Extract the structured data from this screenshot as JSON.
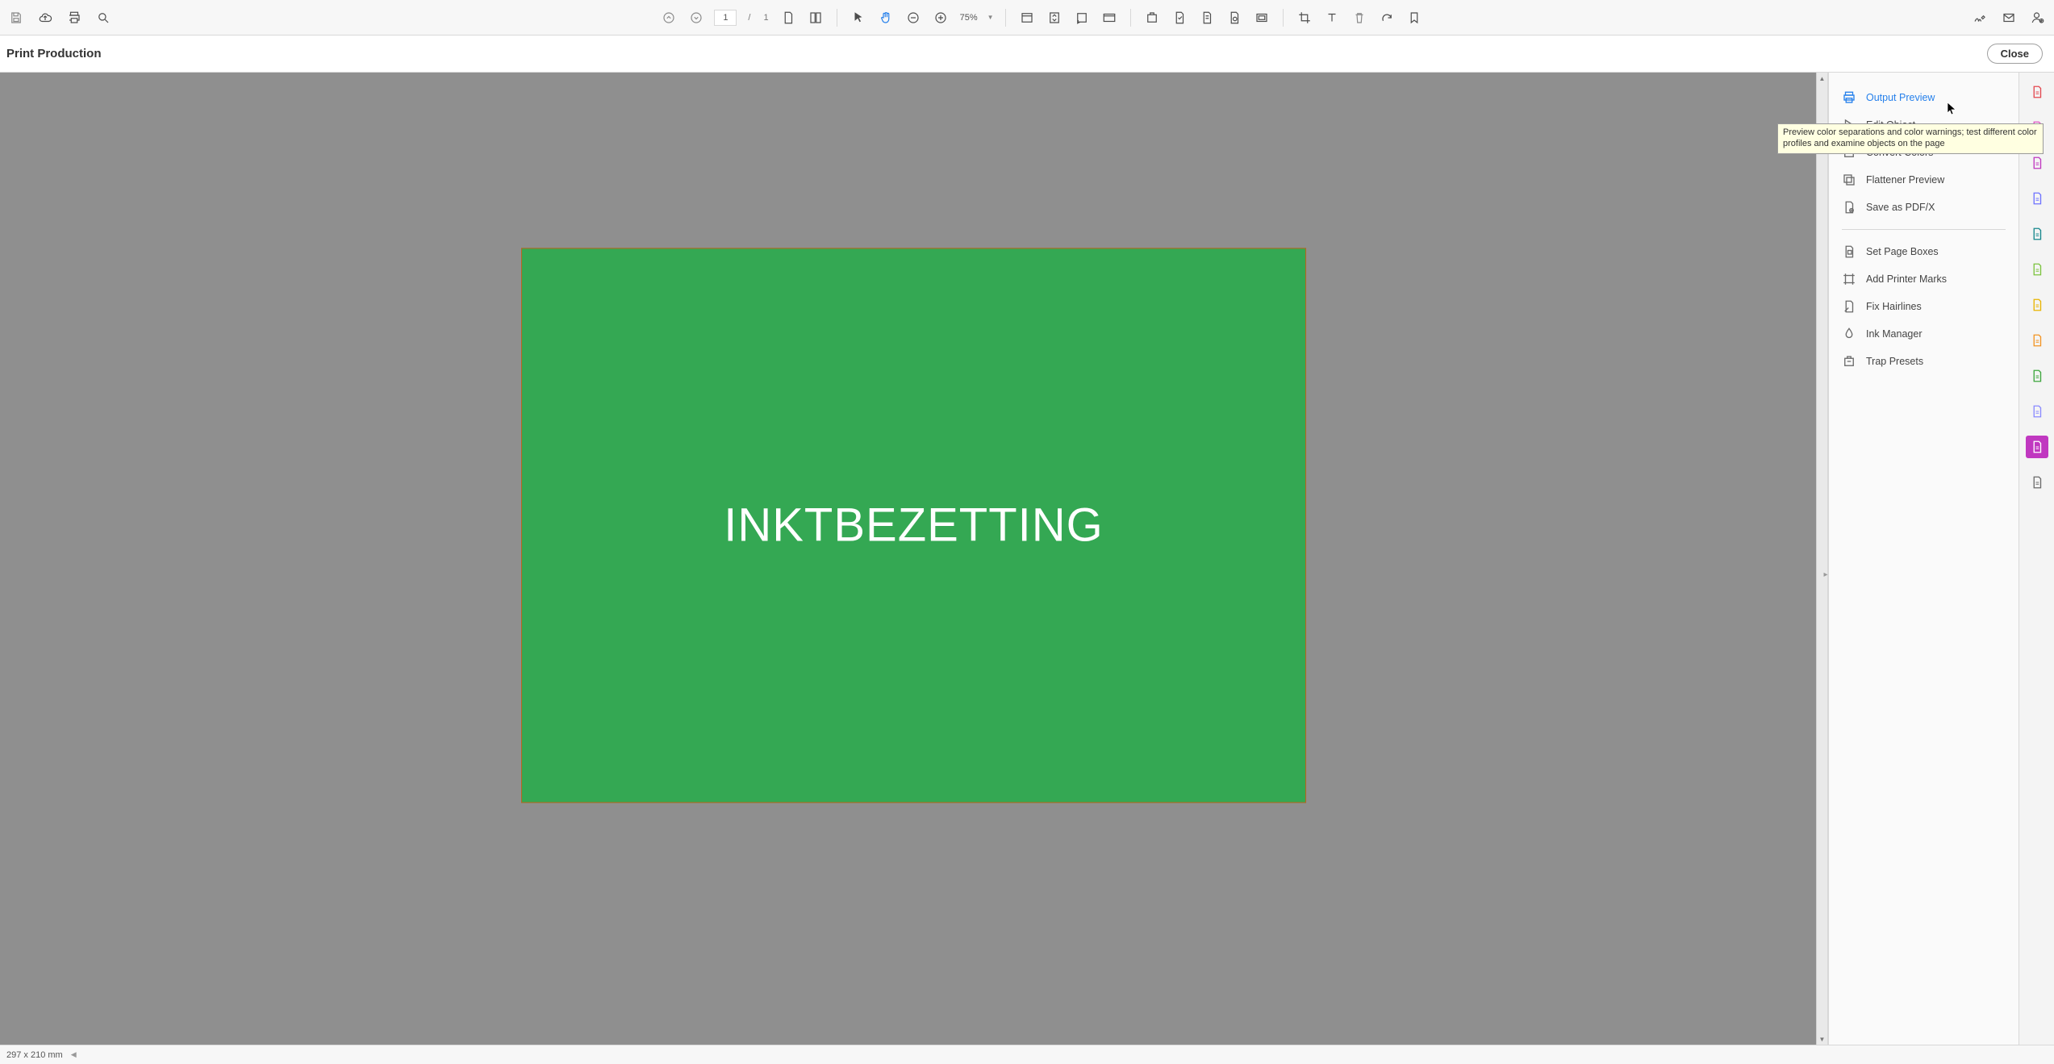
{
  "subheader": {
    "title": "Print Production",
    "close": "Close"
  },
  "toolbar": {
    "page_current": "1",
    "page_total": "1",
    "zoom": "75%"
  },
  "document": {
    "text": "INKTBEZETTING",
    "bg_color": "#34a853",
    "border_color": "#b9641f"
  },
  "panel": {
    "items_a": [
      {
        "key": "output-preview",
        "label": "Output Preview",
        "icon": "printer",
        "selected": true
      },
      {
        "key": "edit-object",
        "label": "Edit Object",
        "icon": "cursor",
        "selected": false
      },
      {
        "key": "convert-colors",
        "label": "Convert Colors",
        "icon": "square",
        "selected": false
      },
      {
        "key": "flattener-preview",
        "label": "Flattener Preview",
        "icon": "layers",
        "selected": false
      },
      {
        "key": "save-pdfx",
        "label": "Save as PDF/X",
        "icon": "save",
        "selected": false
      }
    ],
    "items_b": [
      {
        "key": "set-page-boxes",
        "label": "Set Page Boxes",
        "icon": "crop",
        "selected": false
      },
      {
        "key": "add-printer-marks",
        "label": "Add Printer Marks",
        "icon": "marks",
        "selected": false
      },
      {
        "key": "fix-hairlines",
        "label": "Fix Hairlines",
        "icon": "hairline",
        "selected": false
      },
      {
        "key": "ink-manager",
        "label": "Ink Manager",
        "icon": "ink",
        "selected": false
      },
      {
        "key": "trap-presets",
        "label": "Trap Presets",
        "icon": "trap",
        "selected": false
      }
    ]
  },
  "tooltip": "Preview color separations and color warnings; test different color profiles and examine objects on the page",
  "rail": [
    {
      "key": "create-pdf",
      "color": "#e34850",
      "active": false
    },
    {
      "key": "edit-pdf",
      "color": "#e056c3",
      "active": false
    },
    {
      "key": "export-pdf",
      "color": "#c038c0",
      "active": false
    },
    {
      "key": "sign",
      "color": "#6f73ff",
      "active": false
    },
    {
      "key": "comment",
      "color": "#16878c",
      "active": false
    },
    {
      "key": "organize",
      "color": "#7cc33f",
      "active": false
    },
    {
      "key": "enhance",
      "color": "#e8b400",
      "active": false
    },
    {
      "key": "highlight",
      "color": "#f29423",
      "active": false
    },
    {
      "key": "print-prod",
      "color": "#3da63d",
      "active": false
    },
    {
      "key": "protect",
      "color": "#8a8aff",
      "active": false
    },
    {
      "key": "active-tool",
      "color": "#ffffff",
      "active": true
    },
    {
      "key": "more-tools",
      "color": "#6b6b6b",
      "active": false
    }
  ],
  "status": {
    "dims": "297 x 210 mm"
  }
}
